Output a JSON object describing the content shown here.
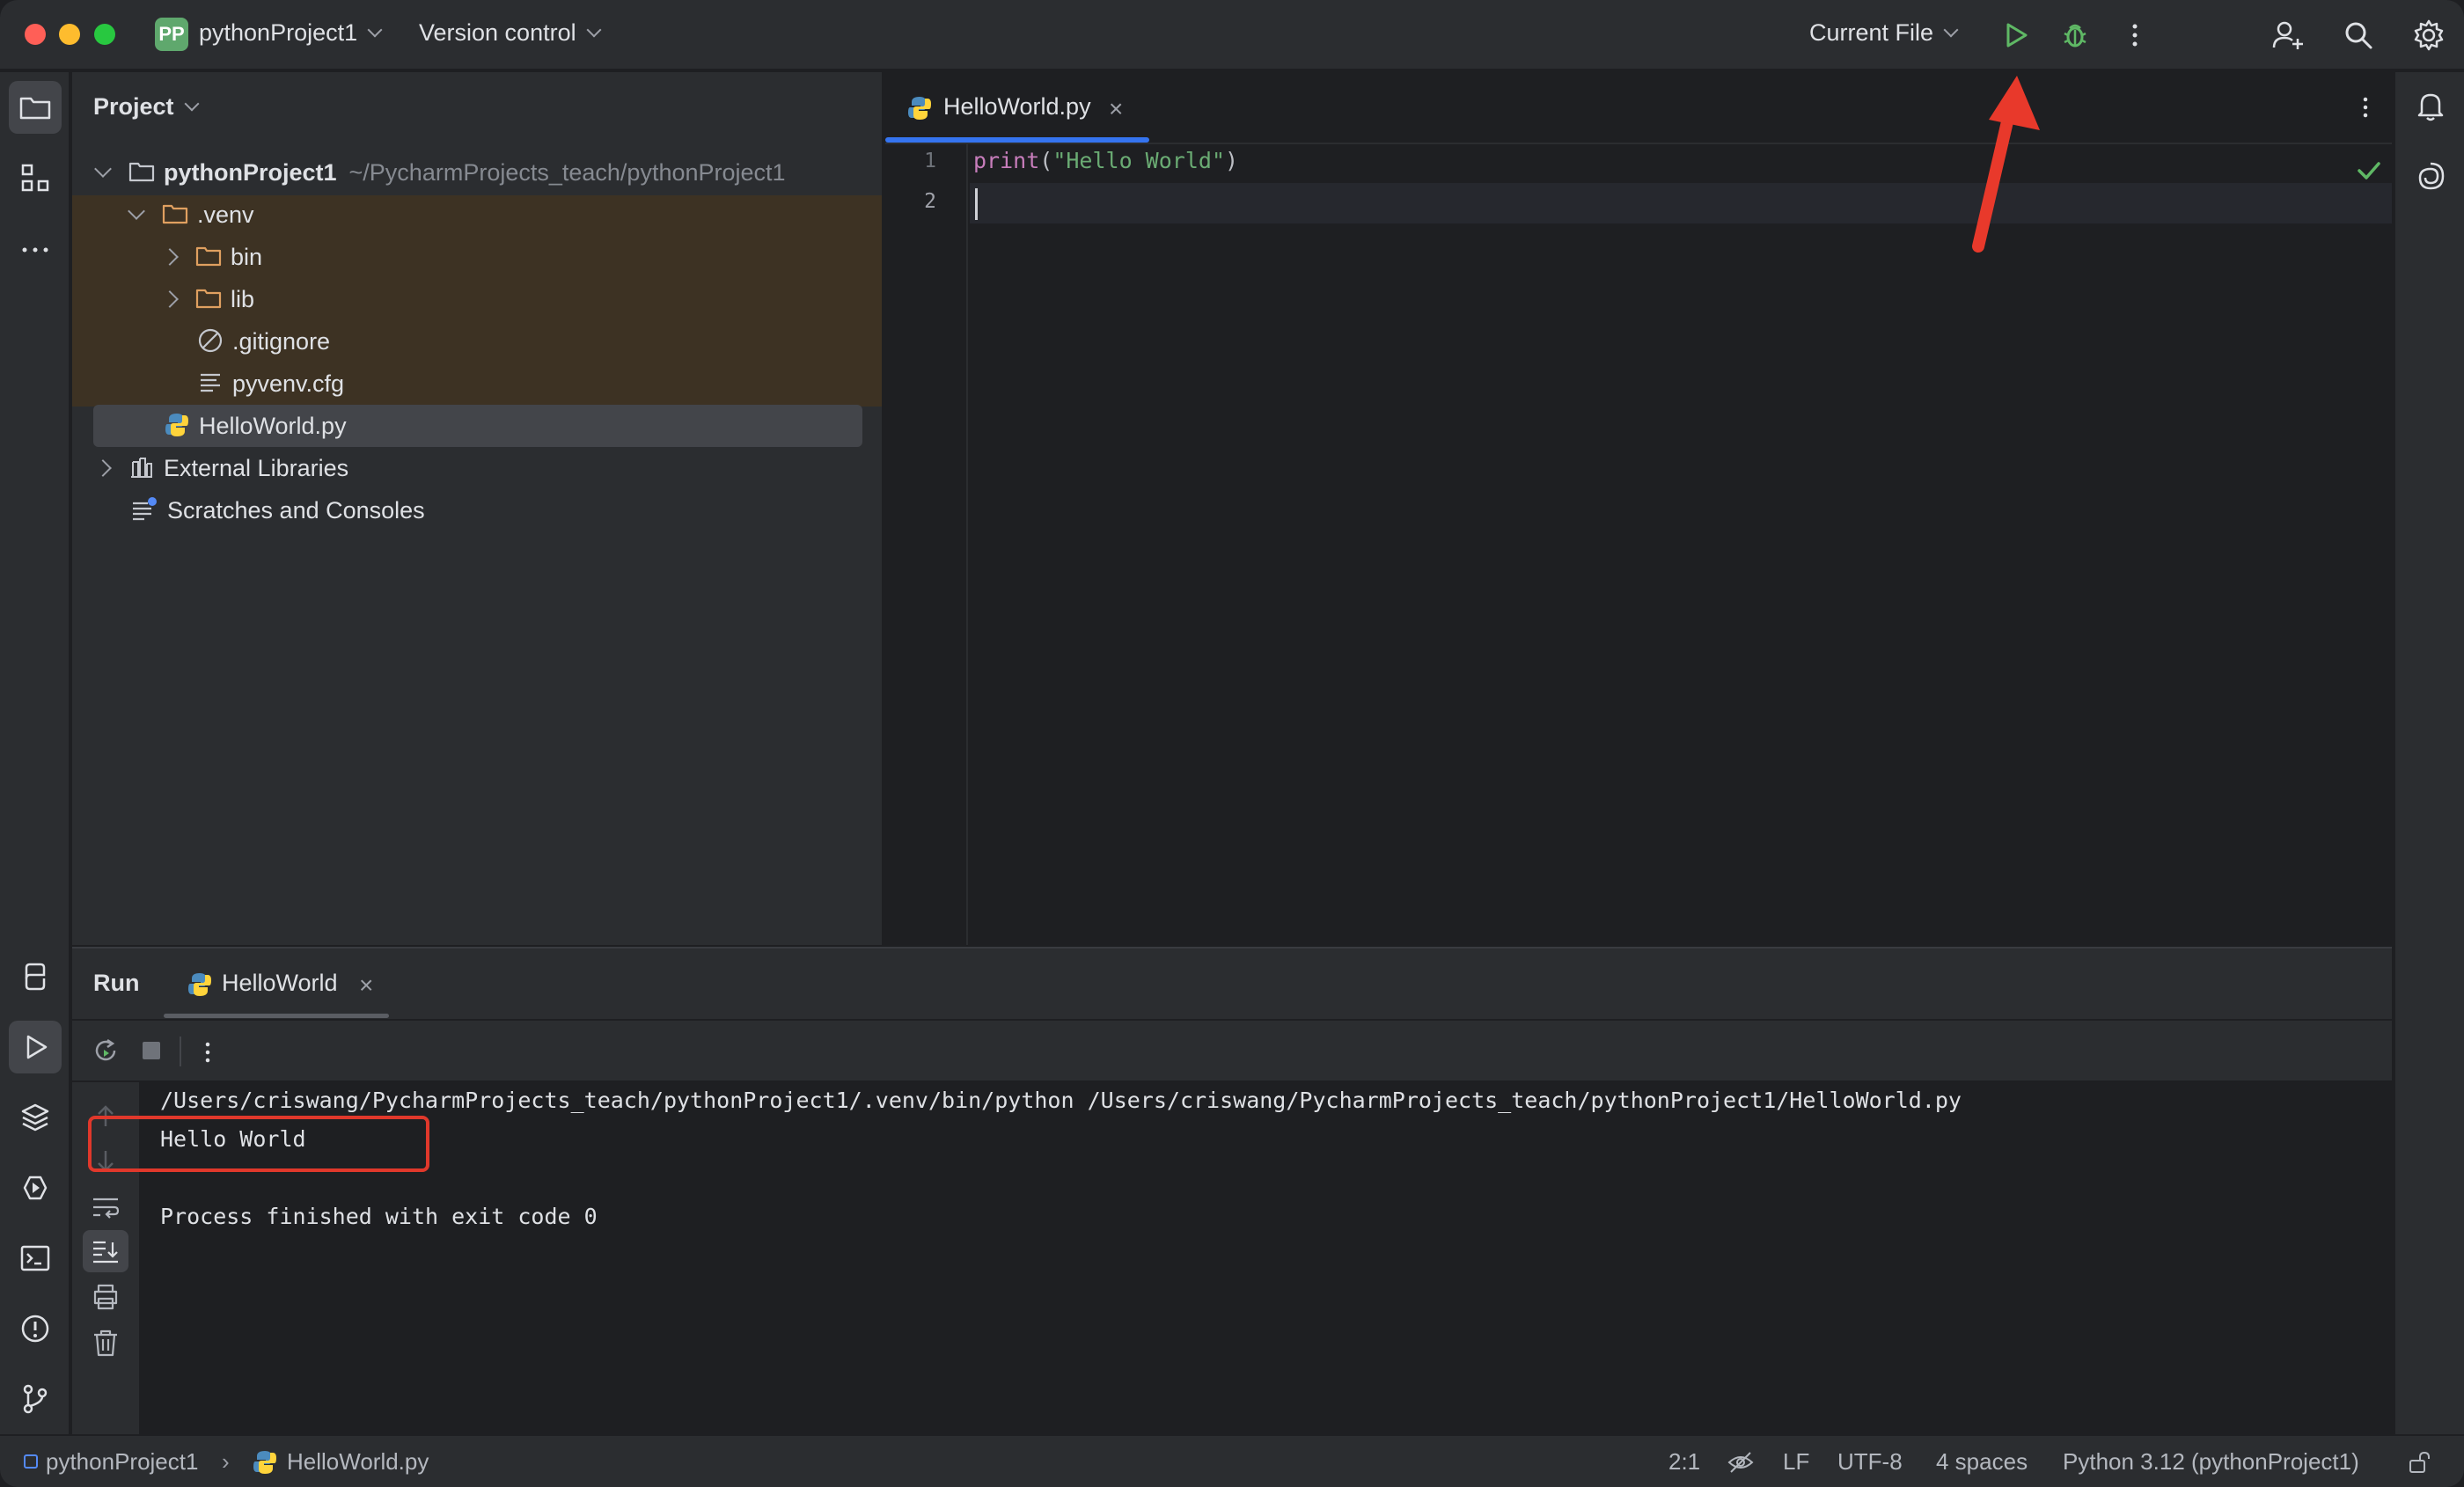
{
  "titlebar": {
    "project_badge": "PP",
    "project_name": "pythonProject1",
    "vcs_label": "Version control",
    "run_config": "Current File"
  },
  "project_panel": {
    "header": "Project",
    "tree": {
      "root_name": "pythonProject1",
      "root_path": "~/PycharmProjects_teach/pythonProject1",
      "venv": ".venv",
      "bin": "bin",
      "lib": "lib",
      "gitignore": ".gitignore",
      "pyvenv": "pyvenv.cfg",
      "helloworld": "HelloWorld.py",
      "external_libraries": "External Libraries",
      "scratches": "Scratches and Consoles"
    }
  },
  "editor": {
    "tab_label": "HelloWorld.py",
    "tab_close": "×",
    "line_numbers": [
      "1",
      "2"
    ],
    "code": {
      "func": "print",
      "open": "(",
      "string": "\"Hello World\"",
      "close": ")"
    }
  },
  "run_panel": {
    "title": "Run",
    "tab_label": "HelloWorld",
    "tab_close": "×",
    "console": {
      "command": "/Users/criswang/PycharmProjects_teach/pythonProject1/.venv/bin/python /Users/criswang/PycharmProjects_teach/pythonProject1/HelloWorld.py",
      "output": "Hello World",
      "exit": "Process finished with exit code 0"
    }
  },
  "statusbar": {
    "breadcrumb_project": "pythonProject1",
    "breadcrumb_file": "HelloWorld.py",
    "position": "2:1",
    "line_ending": "LF",
    "encoding": "UTF-8",
    "indent": "4 spaces",
    "interpreter": "Python 3.12 (pythonProject1)"
  },
  "colors": {
    "accent": "#3574f0",
    "run_green": "#5fb865",
    "annotation_red": "#e0382b",
    "venv_highlight": "#3d3223"
  },
  "icons": {
    "run": "play-icon",
    "debug": "bug-icon",
    "more": "kebab-icon",
    "add_user": "add-user-icon",
    "search": "search-icon",
    "settings": "gear-icon",
    "notifications": "bell-icon",
    "ai": "ai-assistant-icon"
  }
}
